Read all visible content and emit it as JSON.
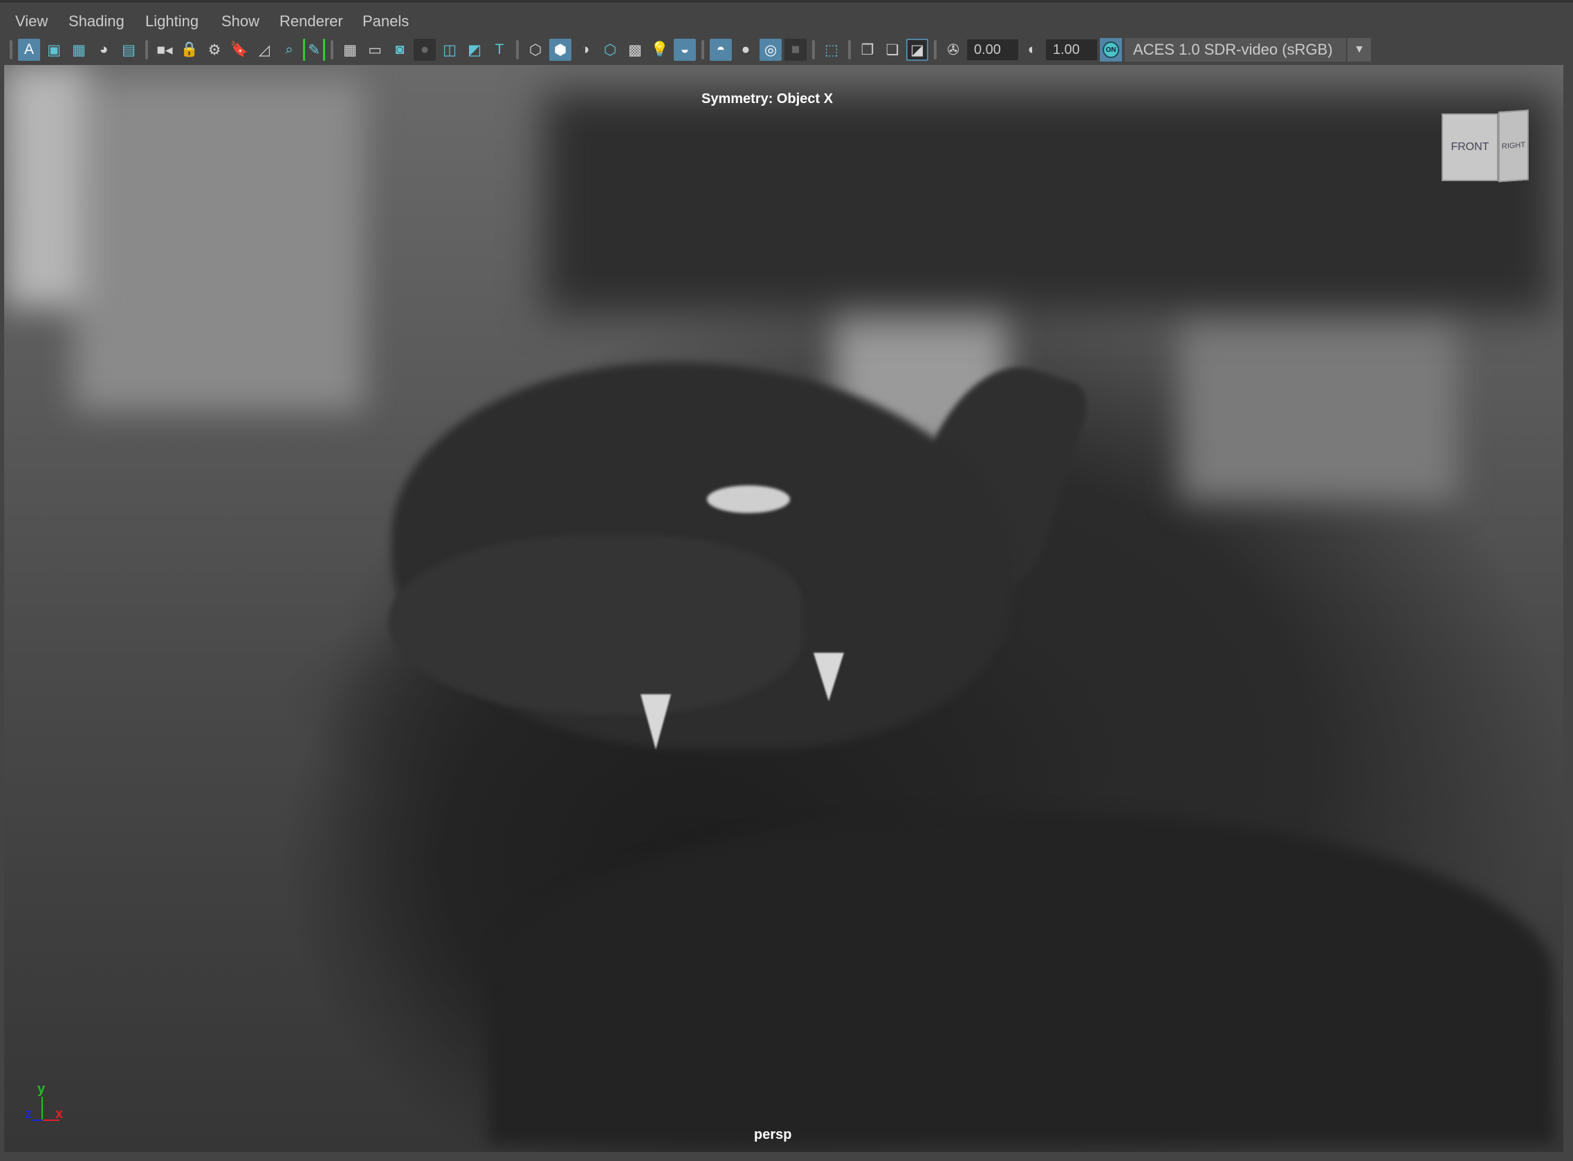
{
  "menu": [
    "View",
    "Shading",
    "Lighting",
    "Show",
    "Renderer",
    "Panels"
  ],
  "toolbar": [
    {
      "t": "sep"
    },
    {
      "t": "icon",
      "name": "select-camera-icon",
      "g": "A",
      "s": "active"
    },
    {
      "t": "icon",
      "name": "film-gate-icon",
      "g": "▣",
      "s": "teal"
    },
    {
      "t": "icon",
      "name": "resolution-gate-icon",
      "g": "▦",
      "s": "teal"
    },
    {
      "t": "icon",
      "name": "color-wheel-icon",
      "g": "◕"
    },
    {
      "t": "icon",
      "name": "image-plane-icon",
      "g": "▤",
      "s": "teal"
    },
    {
      "t": "sep"
    },
    {
      "t": "icon",
      "name": "camera-icon",
      "g": "■◂"
    },
    {
      "t": "icon",
      "name": "lock-camera-icon",
      "g": "🔒"
    },
    {
      "t": "icon",
      "name": "camera-attributes-icon",
      "g": "⚙"
    },
    {
      "t": "icon",
      "name": "bookmark-icon",
      "g": "🔖"
    },
    {
      "t": "icon",
      "name": "pan-zoom-icon",
      "g": "◿"
    },
    {
      "t": "icon",
      "name": "grease-pencil-icon",
      "g": "⌕",
      "s": "teal"
    },
    {
      "t": "icon",
      "name": "pencil-icon",
      "g": "✎",
      "s": "green"
    },
    {
      "t": "sep"
    },
    {
      "t": "icon",
      "name": "grid-icon",
      "g": "▦"
    },
    {
      "t": "icon",
      "name": "film-gate-mask-icon",
      "g": "▭"
    },
    {
      "t": "icon",
      "name": "field-chart-icon",
      "g": "◙",
      "s": "teal"
    },
    {
      "t": "icon",
      "name": "safe-action-icon",
      "g": "●",
      "s": "dark"
    },
    {
      "t": "icon",
      "name": "safe-title-icon",
      "g": "◫",
      "s": "teal"
    },
    {
      "t": "icon",
      "name": "gate-mask-icon",
      "g": "◩",
      "s": "teal"
    },
    {
      "t": "icon",
      "name": "text-icon",
      "g": "T",
      "s": "teal"
    },
    {
      "t": "sep"
    },
    {
      "t": "icon",
      "name": "wireframe-icon",
      "g": "⬡"
    },
    {
      "t": "icon",
      "name": "smooth-shade-icon",
      "g": "⬢",
      "s": "active"
    },
    {
      "t": "icon",
      "name": "default-material-icon",
      "g": "◑"
    },
    {
      "t": "icon",
      "name": "wireframe-on-shaded-icon",
      "g": "⬡",
      "s": "teal"
    },
    {
      "t": "icon",
      "name": "textured-icon",
      "g": "▩"
    },
    {
      "t": "icon",
      "name": "lights-icon",
      "g": "💡"
    },
    {
      "t": "icon",
      "name": "shadows-icon",
      "g": "◒",
      "s": "active"
    },
    {
      "t": "sep"
    },
    {
      "t": "icon",
      "name": "ambient-occlusion-icon",
      "g": "◓",
      "s": "active"
    },
    {
      "t": "icon",
      "name": "motion-blur-icon",
      "g": "●"
    },
    {
      "t": "icon",
      "name": "anti-aliasing-icon",
      "g": "◎",
      "s": "active"
    },
    {
      "t": "icon",
      "name": "depth-of-field-icon",
      "g": "■",
      "s": "dark"
    },
    {
      "t": "sep"
    },
    {
      "t": "icon",
      "name": "isolate-select-icon",
      "g": "⬚",
      "s": "teal"
    },
    {
      "t": "sep"
    },
    {
      "t": "icon",
      "name": "xray-icon",
      "g": "❐"
    },
    {
      "t": "icon",
      "name": "xray-joints-icon",
      "g": "❏"
    },
    {
      "t": "icon",
      "name": "xray-components-icon",
      "g": "◪",
      "s": "outlined"
    },
    {
      "t": "sep"
    },
    {
      "t": "icon",
      "name": "exposure-icon",
      "g": "✇"
    },
    {
      "t": "field",
      "name": "exposure-field",
      "v": "0.00"
    },
    {
      "t": "icon",
      "name": "gamma-icon",
      "g": "◐"
    },
    {
      "t": "field",
      "name": "gamma-field",
      "v": "1.00"
    },
    {
      "t": "on",
      "name": "color-management-toggle",
      "v": "ON"
    },
    {
      "t": "dd",
      "name": "view-transform-dropdown",
      "v": "ACES 1.0 SDR-video (sRGB)"
    }
  ],
  "hud": {
    "symmetry": "Symmetry: Object X",
    "camera": "persp"
  },
  "viewcube": {
    "front": "FRONT",
    "right": "RIGHT"
  },
  "axis": {
    "x": "x",
    "y": "y",
    "z": "z",
    "colors": {
      "x": "#e0202a",
      "y": "#22c022",
      "z": "#1a2ad0"
    }
  },
  "accent": "#5285a6"
}
